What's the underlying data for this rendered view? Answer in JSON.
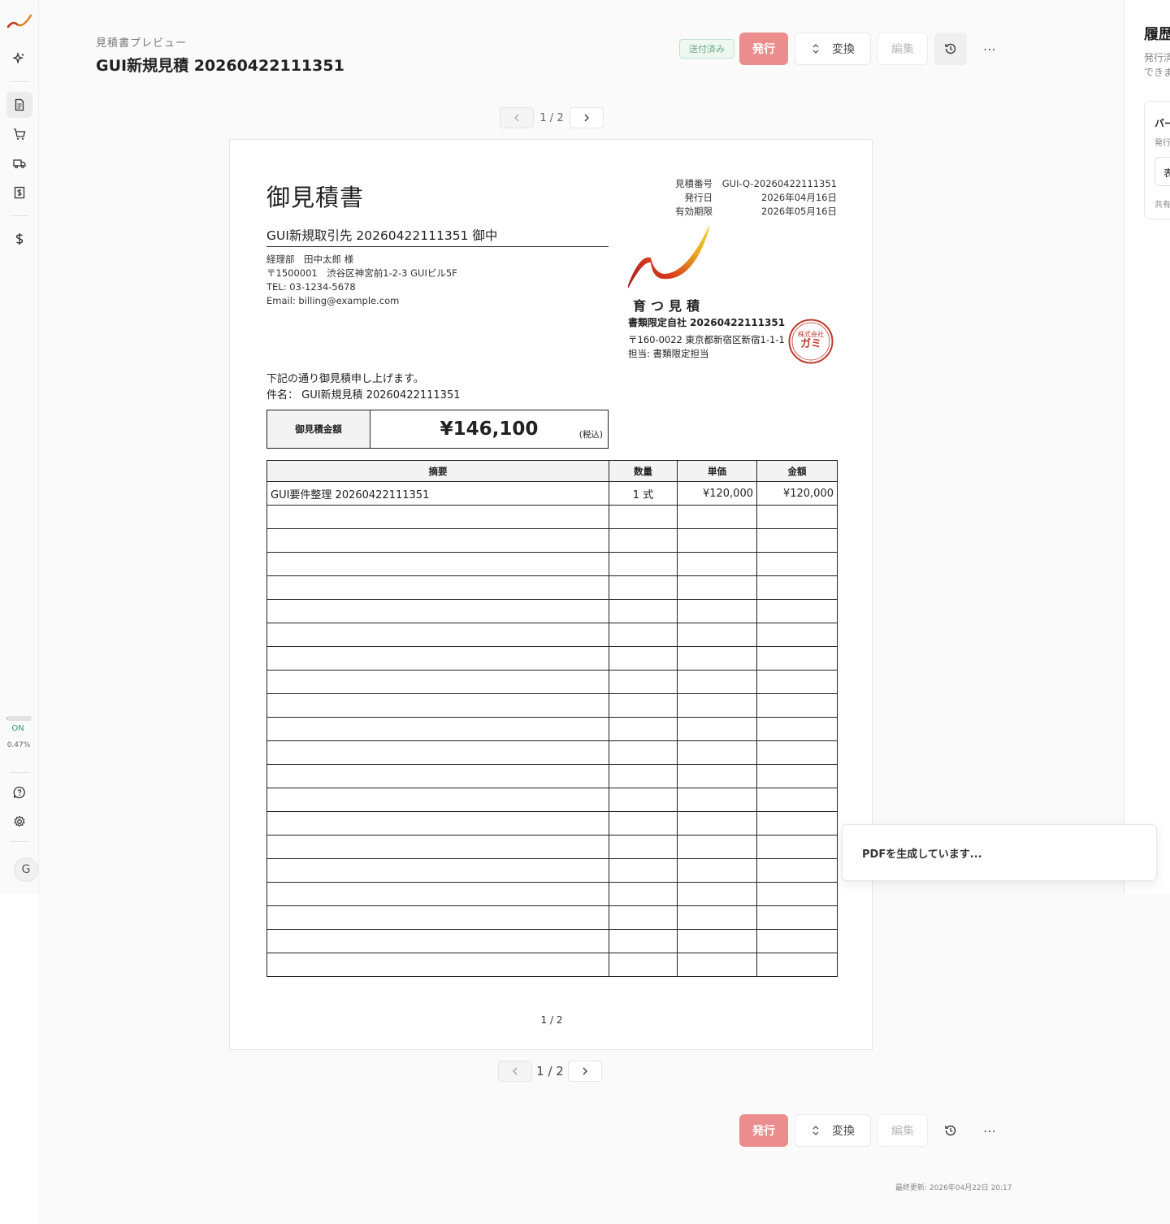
{
  "header": {
    "breadcrumb": "見積書プレビュー",
    "title": "GUI新規見積 20260422111351"
  },
  "toolbar": {
    "status_badge": "送付済み",
    "issue_label": "発行",
    "convert_label": "変換",
    "edit_label": "編集"
  },
  "sidebar": {
    "usage_status": "ON",
    "usage_percent": "0.47%",
    "usage_fraction": 0.0047,
    "avatar_initial": "G"
  },
  "pager": {
    "indicator": "1 / 2"
  },
  "document": {
    "title": "御見積書",
    "meta": [
      {
        "key": "見積番号",
        "value": "GUI-Q-20260422111351"
      },
      {
        "key": "発行日",
        "value": "2026年04月16日"
      },
      {
        "key": "有効期限",
        "value": "2026年05月16日"
      }
    ],
    "client": {
      "name": "GUI新規取引先 20260422111351 御中",
      "contact": "経理部　田中太郎 様",
      "address": "〒1500001　渋谷区神宮前1-2-3 GUIビル5F",
      "tel": "TEL: 03-1234-5678",
      "email": "Email: billing@example.com"
    },
    "issuer": {
      "brand": "育つ見積",
      "company": "書類限定自社 20260422111351",
      "address": "〒160-0022 東京都新宿区新宿1-1-1",
      "staff": "担当: 書類限定担当",
      "seal_top": "株式会社",
      "seal_main": "ガミ"
    },
    "intro_line": "下記の通り御見積申し上げます。",
    "subject": "件名：  GUI新規見積 20260422111351",
    "total_label": "御見積金額",
    "total_amount": "¥146,100",
    "tax_note": "(税込)",
    "columns": [
      "摘要",
      "数量",
      "単価",
      "金額"
    ],
    "rows": [
      [
        "GUI要件整理 20260422111351",
        "1 式",
        "¥120,000",
        "¥120,000"
      ]
    ],
    "page_number": "1 / 2"
  },
  "history_panel": {
    "title": "履歴",
    "description": "発行済みの書類のバージョンを確認できます",
    "card_title": "バージョン",
    "card_sub": "発行",
    "card_field": "表示",
    "card_footer": "共有"
  },
  "toast": {
    "message": "PDFを生成しています..."
  },
  "footer": {
    "last_updated": "最終更新: 2026年04月22日 20:17"
  },
  "colors": {
    "issue_button": "#eb8d8d",
    "sent_badge": "#6aaa84",
    "seal": "#c0392b"
  }
}
